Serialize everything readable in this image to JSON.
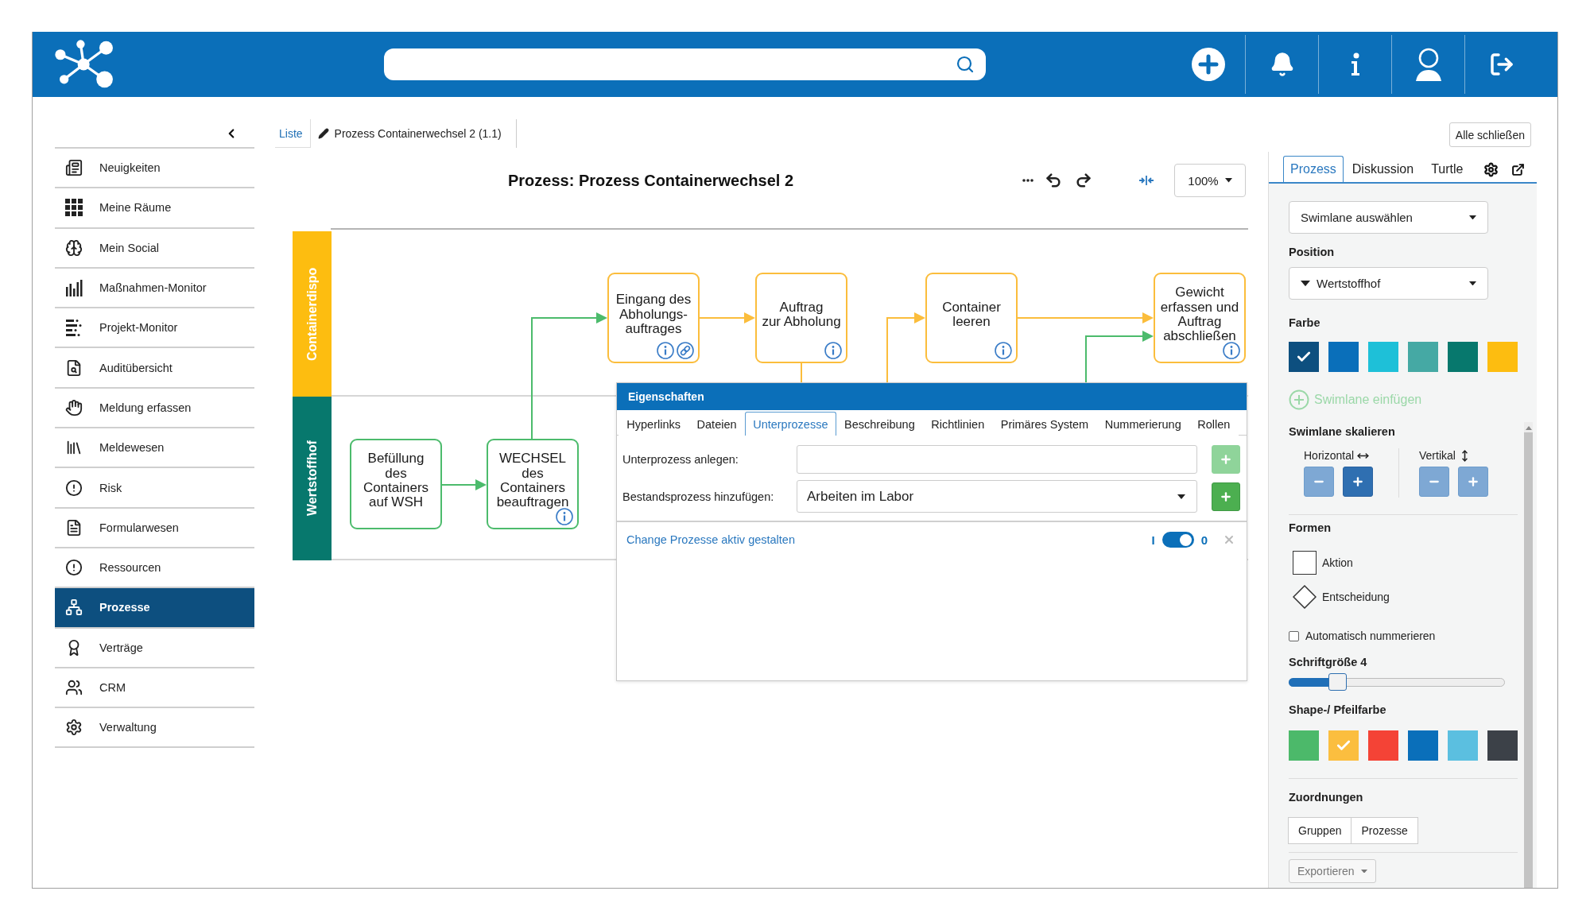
{
  "sidebar": {
    "items": [
      {
        "label": "Neuigkeiten",
        "selected": false
      },
      {
        "label": "Meine Räume",
        "selected": false
      },
      {
        "label": "Mein Social",
        "selected": false
      },
      {
        "label": "Maßnahmen-Monitor",
        "selected": false
      },
      {
        "label": "Projekt-Monitor",
        "selected": false
      },
      {
        "label": "Auditübersicht",
        "selected": false
      },
      {
        "label": "Meldung erfassen",
        "selected": false
      },
      {
        "label": "Meldewesen",
        "selected": false
      },
      {
        "label": "Risk",
        "selected": false
      },
      {
        "label": "Formularwesen",
        "selected": false
      },
      {
        "label": "Ressourcen",
        "selected": false
      },
      {
        "label": "Prozesse",
        "selected": true
      },
      {
        "label": "Verträge",
        "selected": false
      },
      {
        "label": "CRM",
        "selected": false
      },
      {
        "label": "Verwaltung",
        "selected": false
      }
    ]
  },
  "tabs": [
    {
      "label": "Liste",
      "selected": false
    },
    {
      "label": "Prozess Containerwechsel 2 (1.1)",
      "selected": true
    }
  ],
  "editor": {
    "title": "Prozess: Prozess Containerwechsel 2",
    "zoom": "100%",
    "swimlanes": [
      {
        "label": "Containerdispo",
        "color": "#fdbd10"
      },
      {
        "label": "Wertstoffhof",
        "color": "#07786d"
      }
    ],
    "nodes": [
      {
        "label": "Eingang des\nAbholungs-\nauftrages",
        "color": "#fbbd3c",
        "info": true,
        "linked": true
      },
      {
        "label": "Auftrag\nzur Abholung",
        "color": "#fbbd3c",
        "info": true,
        "linked": false
      },
      {
        "label": "Container\nleeren",
        "color": "#fbbd3c",
        "info": true,
        "linked": false
      },
      {
        "label": "Gewicht\nerfassen und\nAuftrag\nabschließen",
        "color": "#fbbd3c",
        "info": true,
        "linked": false
      },
      {
        "label": "Befüllung\ndes\nContainers\nauf WSH",
        "color": "#4cbb6c",
        "info": false,
        "linked": false
      },
      {
        "label": "WECHSEL\ndes\nContainers\nbeauftragen",
        "color": "#4cbb6c",
        "info": true,
        "linked": false
      }
    ]
  },
  "properties": {
    "title": "Eigenschaften",
    "tabs": [
      {
        "label": "Hyperlinks",
        "selected": false
      },
      {
        "label": "Dateien",
        "selected": false
      },
      {
        "label": "Unterprozesse",
        "selected": true
      },
      {
        "label": "Beschreibung",
        "selected": false
      },
      {
        "label": "Richtlinien",
        "selected": false
      },
      {
        "label": "Primäres System",
        "selected": false
      },
      {
        "label": "Nummerierung",
        "selected": false
      },
      {
        "label": "Rollen",
        "selected": false
      }
    ],
    "fields": [
      {
        "kind": "input",
        "label": "Unterprozess anlegen:",
        "add_disabled": true
      },
      {
        "kind": "select",
        "label": "Bestandsprozess hinzufügen:",
        "value": "Arbeiten im Labor",
        "add_disabled": false
      }
    ],
    "subprocesses": [
      {
        "label": "Change Prozesse aktiv gestalten",
        "on_label": "I",
        "off_label": "0",
        "on": true
      }
    ]
  },
  "close_all": "Alle schließen",
  "side_panel": {
    "tabs": [
      {
        "label": "Prozess",
        "selected": true
      },
      {
        "label": "Diskussion",
        "selected": false
      },
      {
        "label": "Turtle",
        "selected": false
      }
    ],
    "swimlane_select": "Swimlane auswählen",
    "position": {
      "label": "Position",
      "value": "Wertstoffhof"
    },
    "color": {
      "label": "Farbe",
      "swatches": [
        {
          "color": "#0d4f7f",
          "selected": true
        },
        {
          "color": "#0a6fba",
          "selected": false
        },
        {
          "color": "#1ec0d8",
          "selected": false
        },
        {
          "color": "#45a9a4",
          "selected": false
        },
        {
          "color": "#07786d",
          "selected": false
        },
        {
          "color": "#fdbd10",
          "selected": false
        }
      ]
    },
    "add_swimlane": {
      "label": "Swimlane einfügen",
      "disabled": true
    },
    "scale": {
      "title": "Swimlane skalieren",
      "axes": [
        {
          "label": "Horizontal",
          "kind": "horizontal",
          "buttons": [
            {
              "kind": "minus",
              "active": false
            },
            {
              "kind": "plus",
              "active": true
            }
          ]
        },
        {
          "label": "Vertikal",
          "kind": "vertical",
          "buttons": [
            {
              "kind": "minus",
              "active": false
            },
            {
              "kind": "plus",
              "active": false
            }
          ]
        }
      ]
    },
    "shapes": {
      "title": "Formen",
      "items": [
        {
          "kind": "rectangle",
          "label": "Aktion"
        },
        {
          "kind": "diamond",
          "label": "Entscheidung"
        }
      ]
    },
    "auto_number": {
      "label": "Automatisch nummerieren",
      "checked": false
    },
    "font_size": {
      "label": "Schriftgröße 4",
      "level": 0.2
    },
    "shape_color": {
      "label": "Shape-/ Pfeilfarbe",
      "swatches": [
        {
          "color": "#4cb96a",
          "selected": false
        },
        {
          "color": "#fbbe3f",
          "selected": true
        },
        {
          "color": "#f44336",
          "selected": false
        },
        {
          "color": "#0a6fba",
          "selected": false
        },
        {
          "color": "#5bbfe0",
          "selected": false
        },
        {
          "color": "#3c4148",
          "selected": false
        }
      ]
    },
    "assignments": {
      "title": "Zuordnungen",
      "buttons": [
        "Gruppen",
        "Prozesse"
      ]
    },
    "export": {
      "label": "Exportieren"
    }
  }
}
